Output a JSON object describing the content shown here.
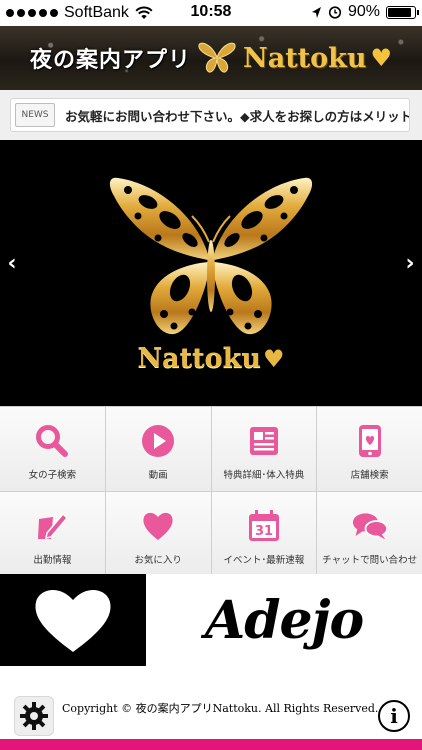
{
  "status_bar": {
    "carrier": "SoftBank",
    "time": "10:58",
    "battery": "90%",
    "battery_level": 0.9
  },
  "header": {
    "title_jp": "夜の案内アプリ",
    "title_en": "Nattoku",
    "heart": "♥"
  },
  "news": {
    "badge": "NEWS",
    "text": "お気軽にお問い合わせ下さい。◆求人をお探しの方はメリット"
  },
  "hero": {
    "brand": "Nattoku",
    "heart": "♥",
    "prev_arrow": "‹",
    "next_arrow": "›"
  },
  "menu": {
    "items": [
      {
        "label": "女の子検索",
        "icon": "search-icon"
      },
      {
        "label": "動画",
        "icon": "play-icon"
      },
      {
        "label": "特典詳細･体入特典",
        "icon": "newspaper-icon"
      },
      {
        "label": "店舗検索",
        "icon": "phone-heart-icon"
      },
      {
        "label": "出勤情報",
        "icon": "edit-icon"
      },
      {
        "label": "お気に入り",
        "icon": "heart-icon"
      },
      {
        "label": "イベント･最新速報",
        "icon": "calendar-icon"
      },
      {
        "label": "チャットで問い合わせ",
        "icon": "chat-icon"
      }
    ],
    "calendar_day": "31"
  },
  "banners": {
    "adejo": "Adejo"
  },
  "footer": {
    "copyright": "Copyright © 夜の案内アプリNattoku. All Rights Reserved.",
    "info": "i"
  },
  "colors": {
    "accent_pink": "#e3157a",
    "icon_pink": "#e8589a",
    "gold": "#e9b842"
  }
}
